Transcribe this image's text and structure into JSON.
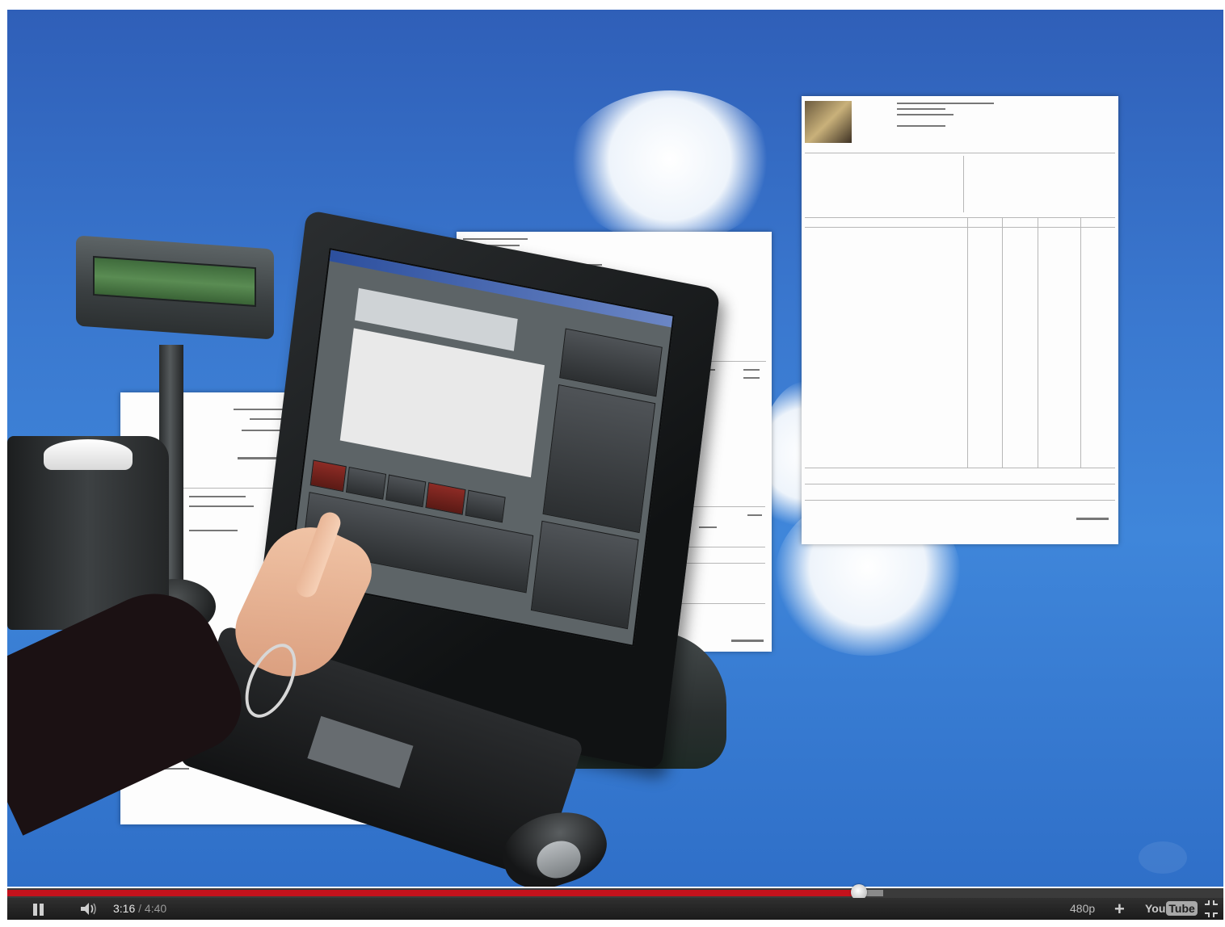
{
  "video": {
    "scene": "pos-cloud-promo"
  },
  "player": {
    "current_time": "3:16",
    "separator": " / ",
    "duration": "4:40",
    "progress_fraction": 0.7,
    "buffered_fraction": 0.72,
    "quality": "480p",
    "add_label": "+",
    "logo_you": "You",
    "logo_tube": "Tube",
    "colors": {
      "progress": "#c4121c",
      "controls_bg": "#1f1f1f"
    }
  },
  "icons": {
    "play_pause": "pause-icon",
    "volume": "volume-icon",
    "fullscreen": "exit-fullscreen-icon"
  }
}
